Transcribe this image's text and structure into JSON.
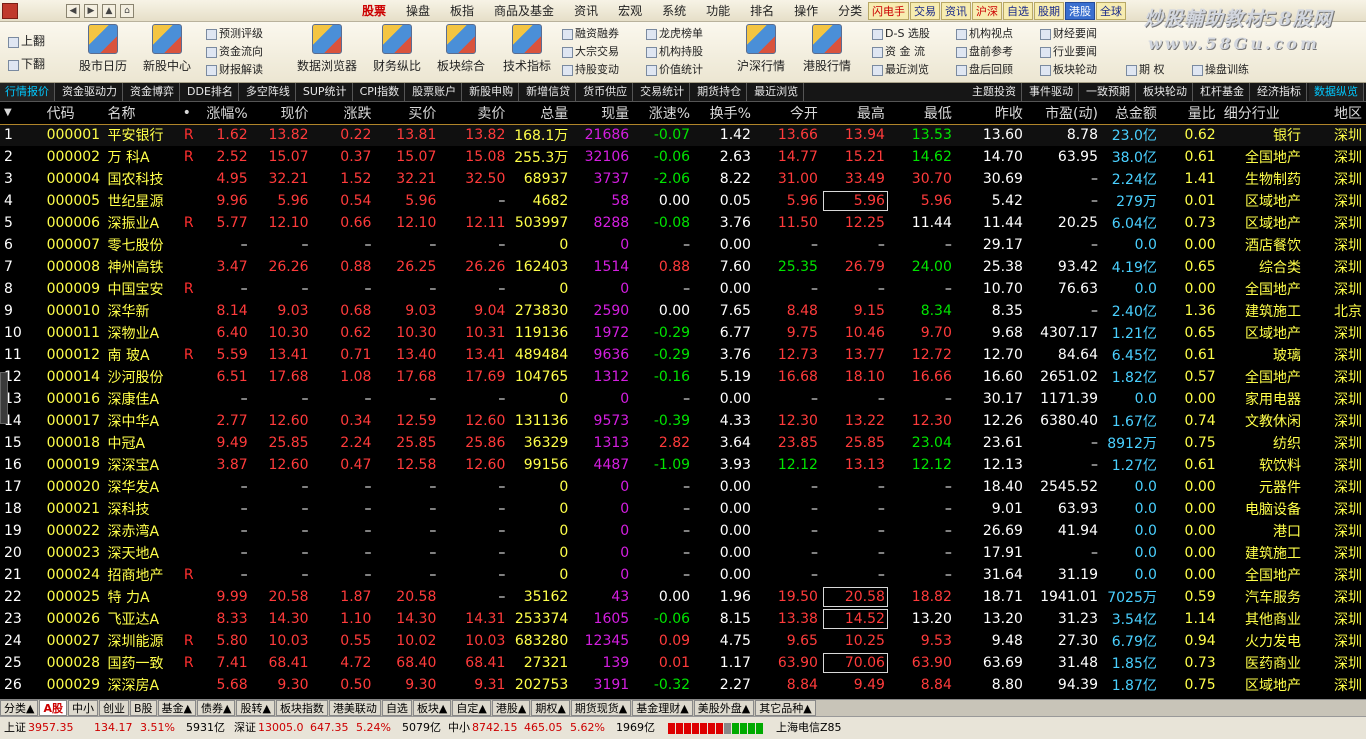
{
  "menubar": {
    "menus": [
      "股票",
      "操盘",
      "板指",
      "商品及基金",
      "资讯",
      "宏观",
      "系统",
      "功能",
      "排名",
      "操作",
      "分类"
    ],
    "active_menu": "股票",
    "quick_tabs": [
      "闪电手",
      "交易",
      "资讯",
      "沪深",
      "自选",
      "股期",
      "港股",
      "全球"
    ],
    "quick_tabs_selected": "港股"
  },
  "watermark": {
    "line1": "炒股輔助教材58股网",
    "line2": "www.58Gu.com"
  },
  "toolbar": {
    "page_up": "上翻",
    "page_down": "下翻",
    "big": [
      "股市日历",
      "新股中心",
      "数据浏览器",
      "财务纵比",
      "板块综合",
      "技术指标",
      "沪深行情",
      "港股行情"
    ],
    "small_col1": [
      "预测评级",
      "资金流向",
      "财报解读"
    ],
    "small_col2": [
      "融资融券",
      "大宗交易",
      "持股变动"
    ],
    "small_col3": [
      "龙虎榜单",
      "机构持股",
      "价值统计"
    ],
    "small_col4": [
      "D-S 选股",
      "资 金 流",
      "最近浏览"
    ],
    "small_col5": [
      "机构视点",
      "盘前参考",
      "盘后回顾"
    ],
    "small_col6": [
      "财经要闻",
      "行业要闻",
      "板块轮动"
    ],
    "small_col7": [
      "期 权",
      "操盘训练"
    ]
  },
  "top_tabs": [
    "行情报价",
    "资金驱动力",
    "资金博弈",
    "DDE排名",
    "多空阵线",
    "SUP统计",
    "CPI指数",
    "股票账户",
    "新股申购",
    "新增信贷",
    "货币供应",
    "交易统计",
    "期货持仓",
    "最近浏览"
  ],
  "top_tabs_selected": "行情报价",
  "top_tabs_right": [
    "主题投资",
    "事件驱动",
    "一致预期",
    "板块轮动",
    "杠杆基金",
    "经济指标",
    "数据纵览"
  ],
  "columns": [
    "代码",
    "名称",
    "•",
    "涨幅%",
    "现价",
    "涨跌",
    "买价",
    "卖价",
    "总量",
    "现量",
    "涨速%",
    "换手%",
    "今开",
    "最高",
    "最低",
    "昨收",
    "市盈(动)",
    "总金额",
    "量比",
    "细分行业",
    "地区"
  ],
  "rows": [
    [
      "1",
      "000001",
      "平安银行",
      "R",
      "1.62",
      "13.82",
      "0.22",
      "13.81",
      "13.82",
      "168.1万",
      "21686",
      "-0.07",
      "1.42",
      "13.66",
      "13.94",
      "13.53",
      "13.60",
      "8.78",
      "23.0亿",
      "0.62",
      "银行",
      "深圳"
    ],
    [
      "2",
      "000002",
      "万 科A",
      "R",
      "2.52",
      "15.07",
      "0.37",
      "15.07",
      "15.08",
      "255.3万",
      "32106",
      "-0.06",
      "2.63",
      "14.77",
      "15.21",
      "14.62",
      "14.70",
      "63.95",
      "38.0亿",
      "0.61",
      "全国地产",
      "深圳"
    ],
    [
      "3",
      "000004",
      "国农科技",
      "",
      "4.95",
      "32.21",
      "1.52",
      "32.21",
      "32.50",
      "68937",
      "3737",
      "-2.06",
      "8.22",
      "31.00",
      "33.49",
      "30.70",
      "30.69",
      "–",
      "2.24亿",
      "1.41",
      "生物制药",
      "深圳"
    ],
    [
      "4",
      "000005",
      "世纪星源",
      "",
      "9.96",
      "5.96",
      "0.54",
      "5.96",
      "–",
      "4682",
      "58",
      "0.00",
      "0.05",
      "5.96",
      "5.96",
      "5.96",
      "5.42",
      "–",
      "279万",
      "0.01",
      "区域地产",
      "深圳"
    ],
    [
      "5",
      "000006",
      "深振业A",
      "R",
      "5.77",
      "12.10",
      "0.66",
      "12.10",
      "12.11",
      "503997",
      "8288",
      "-0.08",
      "3.76",
      "11.50",
      "12.25",
      "11.44",
      "11.44",
      "20.25",
      "6.04亿",
      "0.73",
      "区域地产",
      "深圳"
    ],
    [
      "6",
      "000007",
      "零七股份",
      "",
      "–",
      "–",
      "–",
      "–",
      "–",
      "0",
      "0",
      "–",
      "0.00",
      "–",
      "–",
      "–",
      "29.17",
      "–",
      "0.0",
      "0.00",
      "酒店餐饮",
      "深圳"
    ],
    [
      "7",
      "000008",
      "神州高铁",
      "",
      "3.47",
      "26.26",
      "0.88",
      "26.25",
      "26.26",
      "162403",
      "1514",
      "0.88",
      "7.60",
      "25.35",
      "26.79",
      "24.00",
      "25.38",
      "93.42",
      "4.19亿",
      "0.65",
      "综合类",
      "深圳"
    ],
    [
      "8",
      "000009",
      "中国宝安",
      "R",
      "–",
      "–",
      "–",
      "–",
      "–",
      "0",
      "0",
      "–",
      "0.00",
      "–",
      "–",
      "–",
      "10.70",
      "76.63",
      "0.0",
      "0.00",
      "全国地产",
      "深圳"
    ],
    [
      "9",
      "000010",
      "深华新",
      "",
      "8.14",
      "9.03",
      "0.68",
      "9.03",
      "9.04",
      "273830",
      "2590",
      "0.00",
      "7.65",
      "8.48",
      "9.15",
      "8.34",
      "8.35",
      "–",
      "2.40亿",
      "1.36",
      "建筑施工",
      "北京"
    ],
    [
      "10",
      "000011",
      "深物业A",
      "",
      "6.40",
      "10.30",
      "0.62",
      "10.30",
      "10.31",
      "119136",
      "1972",
      "-0.29",
      "6.77",
      "9.75",
      "10.46",
      "9.70",
      "9.68",
      "4307.17",
      "1.21亿",
      "0.65",
      "区域地产",
      "深圳"
    ],
    [
      "11",
      "000012",
      "南 玻A",
      "R",
      "5.59",
      "13.41",
      "0.71",
      "13.40",
      "13.41",
      "489484",
      "9636",
      "-0.29",
      "3.76",
      "12.73",
      "13.77",
      "12.72",
      "12.70",
      "84.64",
      "6.45亿",
      "0.61",
      "玻璃",
      "深圳"
    ],
    [
      "12",
      "000014",
      "沙河股份",
      "",
      "6.51",
      "17.68",
      "1.08",
      "17.68",
      "17.69",
      "104765",
      "1312",
      "-0.16",
      "5.19",
      "16.68",
      "18.10",
      "16.66",
      "16.60",
      "2651.02",
      "1.82亿",
      "0.57",
      "全国地产",
      "深圳"
    ],
    [
      "13",
      "000016",
      "深康佳A",
      "",
      "–",
      "–",
      "–",
      "–",
      "–",
      "0",
      "0",
      "–",
      "0.00",
      "–",
      "–",
      "–",
      "30.17",
      "1171.39",
      "0.0",
      "0.00",
      "家用电器",
      "深圳"
    ],
    [
      "14",
      "000017",
      "深中华A",
      "",
      "2.77",
      "12.60",
      "0.34",
      "12.59",
      "12.60",
      "131136",
      "9573",
      "-0.39",
      "4.33",
      "12.30",
      "13.22",
      "12.30",
      "12.26",
      "6380.40",
      "1.67亿",
      "0.74",
      "文教休闲",
      "深圳"
    ],
    [
      "15",
      "000018",
      "中冠A",
      "",
      "9.49",
      "25.85",
      "2.24",
      "25.85",
      "25.86",
      "36329",
      "1313",
      "2.82",
      "3.64",
      "23.85",
      "25.85",
      "23.04",
      "23.61",
      "–",
      "8912万",
      "0.75",
      "纺织",
      "深圳"
    ],
    [
      "16",
      "000019",
      "深深宝A",
      "",
      "3.87",
      "12.60",
      "0.47",
      "12.58",
      "12.60",
      "99156",
      "4487",
      "-1.09",
      "3.93",
      "12.12",
      "13.13",
      "12.12",
      "12.13",
      "–",
      "1.27亿",
      "0.61",
      "软饮料",
      "深圳"
    ],
    [
      "17",
      "000020",
      "深华发A",
      "",
      "–",
      "–",
      "–",
      "–",
      "–",
      "0",
      "0",
      "–",
      "0.00",
      "–",
      "–",
      "–",
      "18.40",
      "2545.52",
      "0.0",
      "0.00",
      "元器件",
      "深圳"
    ],
    [
      "18",
      "000021",
      "深科技",
      "",
      "–",
      "–",
      "–",
      "–",
      "–",
      "0",
      "0",
      "–",
      "0.00",
      "–",
      "–",
      "–",
      "9.01",
      "63.93",
      "0.0",
      "0.00",
      "电脑设备",
      "深圳"
    ],
    [
      "19",
      "000022",
      "深赤湾A",
      "",
      "–",
      "–",
      "–",
      "–",
      "–",
      "0",
      "0",
      "–",
      "0.00",
      "–",
      "–",
      "–",
      "26.69",
      "41.94",
      "0.0",
      "0.00",
      "港口",
      "深圳"
    ],
    [
      "20",
      "000023",
      "深天地A",
      "",
      "–",
      "–",
      "–",
      "–",
      "–",
      "0",
      "0",
      "–",
      "0.00",
      "–",
      "–",
      "–",
      "17.91",
      "–",
      "0.0",
      "0.00",
      "建筑施工",
      "深圳"
    ],
    [
      "21",
      "000024",
      "招商地产",
      "R",
      "–",
      "–",
      "–",
      "–",
      "–",
      "0",
      "0",
      "–",
      "0.00",
      "–",
      "–",
      "–",
      "31.64",
      "31.19",
      "0.0",
      "0.00",
      "全国地产",
      "深圳"
    ],
    [
      "22",
      "000025",
      "特 力A",
      "",
      "9.99",
      "20.58",
      "1.87",
      "20.58",
      "–",
      "35162",
      "43",
      "0.00",
      "1.96",
      "19.50",
      "20.58",
      "18.82",
      "18.71",
      "1941.01",
      "7025万",
      "0.59",
      "汽车服务",
      "深圳"
    ],
    [
      "23",
      "000026",
      "飞亚达A",
      "",
      "8.33",
      "14.30",
      "1.10",
      "14.30",
      "14.31",
      "253374",
      "1605",
      "-0.06",
      "8.15",
      "13.38",
      "14.52",
      "13.20",
      "13.20",
      "31.23",
      "3.54亿",
      "1.14",
      "其他商业",
      "深圳"
    ],
    [
      "24",
      "000027",
      "深圳能源",
      "R",
      "5.80",
      "10.03",
      "0.55",
      "10.02",
      "10.03",
      "683280",
      "12345",
      "0.09",
      "4.75",
      "9.65",
      "10.25",
      "9.53",
      "9.48",
      "27.30",
      "6.79亿",
      "0.94",
      "火力发电",
      "深圳"
    ],
    [
      "25",
      "000028",
      "国药一致",
      "R",
      "7.41",
      "68.41",
      "4.72",
      "68.40",
      "68.41",
      "27321",
      "139",
      "0.01",
      "1.17",
      "63.90",
      "70.06",
      "63.90",
      "63.69",
      "31.48",
      "1.85亿",
      "0.73",
      "医药商业",
      "深圳"
    ],
    [
      "26",
      "000029",
      "深深房A",
      "",
      "5.68",
      "9.30",
      "0.50",
      "9.30",
      "9.31",
      "202753",
      "3191",
      "-0.32",
      "2.27",
      "8.84",
      "9.49",
      "8.84",
      "8.80",
      "94.39",
      "1.87亿",
      "0.75",
      "区域地产",
      "深圳"
    ]
  ],
  "bottom_tabs": [
    "分类▲",
    "A股",
    "中小",
    "创业",
    "B股",
    "基金▲",
    "债券▲",
    "股转▲",
    "板块指数",
    "港美联动",
    "自选",
    "板块▲",
    "自定▲",
    "港股▲",
    "期权▲",
    "期货现货▲",
    "基金理财▲",
    "美股外盘▲",
    "其它品种▲"
  ],
  "bottom_tabs_selected": "A股",
  "status": {
    "sh_label": "上证",
    "sh_value": "3957.35",
    "sh_change": "134.17",
    "sh_pct": "3.51%",
    "sh_amount": "5931亿",
    "sz_label": "深证",
    "sz_value": "13005.0",
    "sz_change": "647.35",
    "sz_pct": "5.24%",
    "sz_amount": "5079亿",
    "zx_label": "中小",
    "zx_value": "8742.15",
    "zx_change": "465.05",
    "zx_pct": "5.62%",
    "zx_amount": "1969亿",
    "server": "上海电信Z85"
  },
  "colors": {
    "up": "#ff3b3b",
    "down": "#00e400",
    "code": "#ffff4a",
    "amount": "#4ad0ff",
    "volume_now": "#d41ee0"
  }
}
